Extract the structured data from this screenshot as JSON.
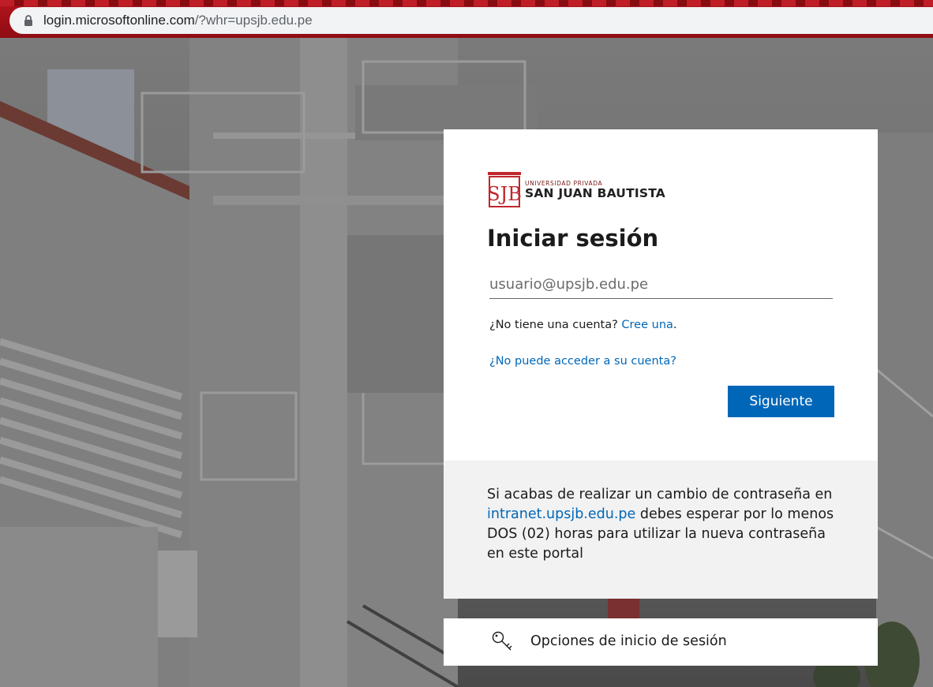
{
  "browser": {
    "url_host": "login.microsoftonline.com",
    "url_rest": "/?whr=upsjb.edu.pe"
  },
  "logo": {
    "monogram": "SJB",
    "line_small": "UNIVERSIDAD PRIVADA",
    "line_big": "SAN JUAN BAUTISTA"
  },
  "login": {
    "title": "Iniciar sesión",
    "email_placeholder": "usuario@upsjb.edu.pe",
    "no_account_text": "¿No tiene una cuenta?",
    "create_link": "Cree una",
    "create_suffix": ".",
    "cant_access_link": "¿No puede acceder a su cuenta?",
    "next_button": "Siguiente"
  },
  "notice": {
    "text_before": "Si acabas de realizar un cambio de contraseña en ",
    "link": "intranet.upsjb.edu.pe",
    "text_after": " debes esperar por lo menos DOS (02) horas para utilizar la nueva contraseña en este portal"
  },
  "options": {
    "label": "Opciones de inicio de sesión",
    "icon": "key-icon"
  },
  "colors": {
    "accent": "#0067b8",
    "chrome": "#a8111a",
    "brand_red": "#c0272d"
  }
}
